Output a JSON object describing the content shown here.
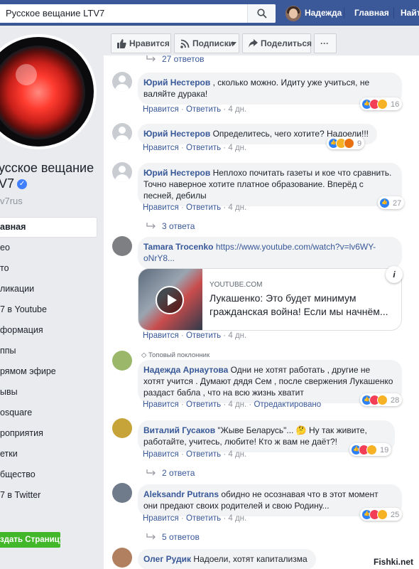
{
  "topbar": {
    "search_value": "Русское вещание LTV7",
    "user_name": "Надежда",
    "home": "Главная",
    "find": "Найт"
  },
  "left": {
    "page_name_line1": "усское вещание",
    "page_name_line2": "V7",
    "handle": "v7rus",
    "nav": [
      "авная",
      "ео",
      "то",
      "ликации",
      "7 в Youtube",
      "формация",
      "ппы",
      "рямом эфире",
      "ывы",
      "osquare",
      "роприятия",
      "етки",
      "бщество",
      "7 в Twitter"
    ],
    "create_button": "здать Страницу"
  },
  "actions": {
    "like": "Нравится",
    "follow": "Подписки",
    "share": "Поделиться",
    "more": "···"
  },
  "labels": {
    "like": "Нравится",
    "reply": "Ответить",
    "edited": "Отредактировано"
  },
  "partial_replies": "27 ответов",
  "comments": [
    {
      "author": "Юрий Нестеров",
      "text": " , сколько можно. Идиту уже учиться, не валяйте дурака!",
      "time": "4 дн.",
      "reactions": 16
    },
    {
      "author": "Юрий Нестеров",
      "text": " Определитесь, чего хотите? Надоели!!!",
      "time": "4 дн.",
      "reactions": 9
    },
    {
      "author": "Юрий Нестеров",
      "text": " Неплохо почитать газеты и кое что сравнить. Точно наверное хотите платное образование. Вперёд с песней, дебилы",
      "time": "4 дн.",
      "reactions": 27,
      "replies": "3 ответа"
    },
    {
      "author": "Tamara Trocenko",
      "link": "https://www.youtube.com/watch?v=lv6WY-oNrY8...",
      "time": "4 дн.",
      "card_source": "YOUTUBE.COM",
      "card_title": "Лукашенко: Это будет минимум гражданская война! Если мы начнём..."
    },
    {
      "badge": "Топовый поклонник",
      "author": "Надежда Арнаутова",
      "text": " Одни не хотят работать , другие не хотят учится . Думают дядя Сем , после свержения Лукашенко раздаст бабла , что на всю жизнь хватит",
      "time": "4 дн.",
      "reactions": 28
    },
    {
      "author": "Виталий Гусаков",
      "text": " \"Жыве Беларусь\"... 🤔 Ну так живите, работайте, учитесь, любите! Кто ж вам не даёт?!",
      "time": "4 дн.",
      "reactions": 19,
      "replies": "2 ответа"
    },
    {
      "author": "Aleksandr Putrans",
      "text": " обидно не осознавая что в этот момент они предают своих родителей и свою Родину...",
      "time": "4 дн.",
      "reactions": 25,
      "replies": "5 ответов"
    },
    {
      "author": "Олег Рудик",
      "text": " Надоели, хотят капитализма"
    }
  ],
  "watermark": "Fishki.net"
}
